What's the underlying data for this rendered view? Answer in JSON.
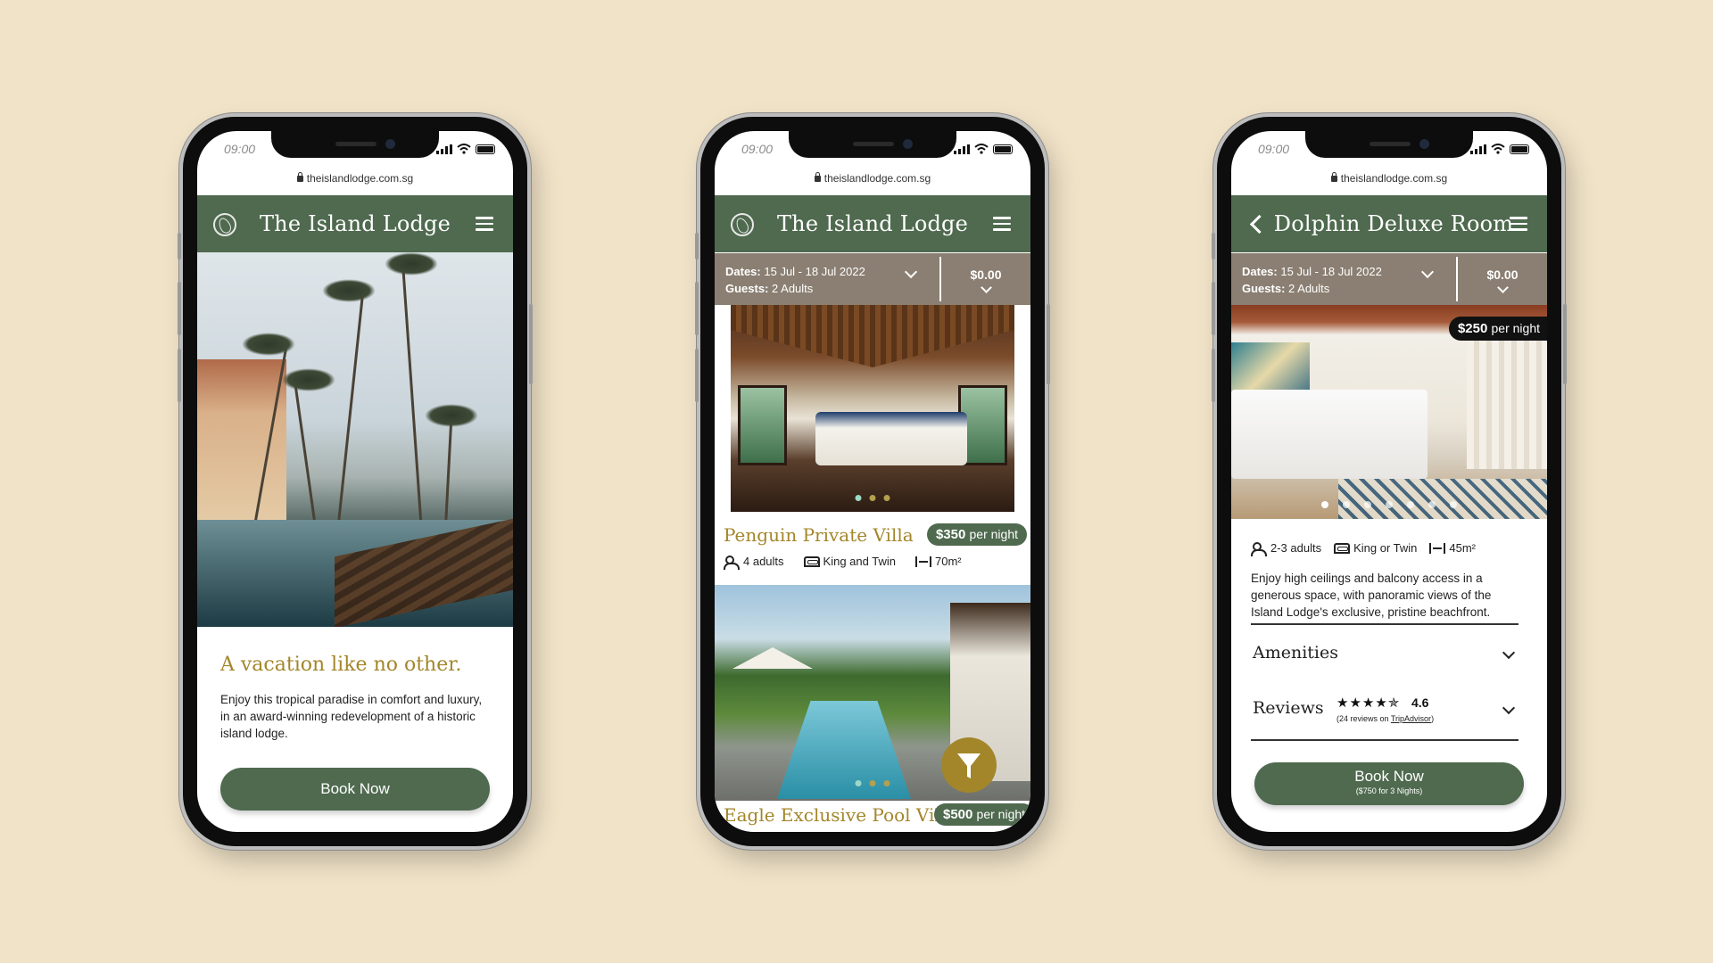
{
  "status": {
    "time": "09:00"
  },
  "url": "theislandlodge.com.sg",
  "phone1": {
    "title": "The Island Lodge",
    "heading": "A vacation like no other.",
    "body": "Enjoy this tropical paradise in comfort and luxury, in an award-winning redevelopment of a historic island lodge.",
    "button": "Book Now"
  },
  "phone2": {
    "title": "The Island Lodge",
    "bar": {
      "dates_label": "Dates:",
      "dates": "15 Jul - 18 Jul 2022",
      "guests_label": "Guests:",
      "guests": "2 Adults",
      "price": "$0.00"
    },
    "rooms": [
      {
        "name": "Penguin Private Villa",
        "price": "$350",
        "per": "per night",
        "adults": "4 adults",
        "bed": "King and Twin",
        "size": "70m²"
      },
      {
        "name": "Eagle Exclusive Pool Villa",
        "price": "$500",
        "per": "per night"
      }
    ]
  },
  "phone3": {
    "title": "Dolphin Deluxe Room",
    "bar": {
      "dates_label": "Dates:",
      "dates": "15 Jul - 18 Jul 2022",
      "guests_label": "Guests:",
      "guests": "2 Adults",
      "price": "$0.00"
    },
    "price": "$250",
    "per": "per night",
    "adults": "2-3 adults",
    "bed": "King or Twin",
    "size": "45m²",
    "description": "Enjoy high ceilings and balcony access in a generous space, with panoramic views of the Island Lodge's exclusive, pristine beachfront.",
    "amenities": "Amenities",
    "reviews": "Reviews",
    "stars": "★★★★✯",
    "rating": "4.6",
    "review_count": "(24 reviews on ",
    "review_source": "TripAdvisor",
    "review_close": ")",
    "button": "Book Now",
    "button_sub": "($750 for 3 Nights)"
  },
  "colors": {
    "primary": "#4f6a4f",
    "gold": "#a3862a",
    "bar": "#8a7f72",
    "background": "#f1e3c8"
  },
  "icons": [
    "lock-icon",
    "logo-icon",
    "menu-icon",
    "back-icon",
    "chevron-down-icon",
    "people-icon",
    "bed-icon",
    "size-icon",
    "filter-icon"
  ]
}
